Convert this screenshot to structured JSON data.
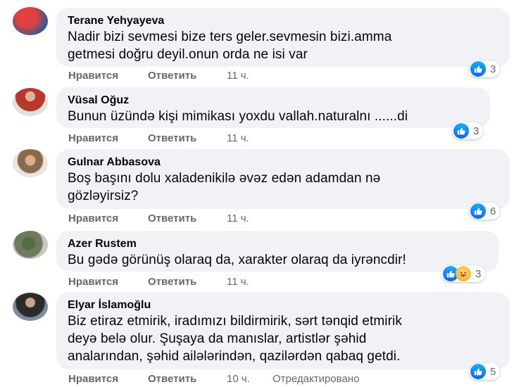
{
  "action_labels": {
    "like": "Нравится",
    "reply": "Ответить"
  },
  "comments": [
    {
      "author": "Terane Yehyayeva",
      "lines": [
        "Nadir bizi sevmesi bize ters geler.sevmesin bizi.amma",
        "getmesi doğru deyil.onun orda ne isi var"
      ],
      "time": "11 ч.",
      "reaction_count": "3",
      "reactions": [
        "like-icon"
      ],
      "avatar_colors": [
        "#c8202a",
        "#3a5a8c"
      ]
    },
    {
      "author": "Vüsal Oğuz",
      "lines": [
        "Bunun üzündə kişi mimikası yoxdu vallah.naturalnı ......di"
      ],
      "time": "11 ч.",
      "reaction_count": "3",
      "reactions": [
        "like-icon"
      ],
      "avatar_colors": [
        "#b9372b",
        "#e3e0dc"
      ]
    },
    {
      "author": "Gulnar Abbasova",
      "lines": [
        "Boş başını dolu xaladenikilə əvəz edən adamdan nə",
        "gözləyirsiz?"
      ],
      "time": "11 ч.",
      "reaction_count": "6",
      "reactions": [
        "like-icon"
      ],
      "avatar_colors": [
        "#8a6a4a",
        "#e9e6e2"
      ]
    },
    {
      "author": "Azer Rustem",
      "lines": [
        "Bu gədə görünüş olaraq da, xarakter olaraq da iyrəncdir!"
      ],
      "time": "11 ч.",
      "reaction_count": "3",
      "reactions": [
        "like-icon",
        "haha-icon"
      ],
      "avatar_colors": [
        "#6f7a5f",
        "#c9c7c0"
      ]
    },
    {
      "author": "Elyar İslamoğlu",
      "lines": [
        "Biz etiraz etmirik, iradımızı bildirmirik, sərt tənqid etmirik",
        "deyə belə olur. Şuşaya da manıslar, artistlər şəhid",
        "analarından, şəhid ailələrindən, qazilərdən qabaq getdi."
      ],
      "time": "10 ч.",
      "edited": "Отредактировано",
      "reaction_count": "5",
      "reactions": [
        "like-icon"
      ],
      "avatar_colors": [
        "#2b2b2b",
        "#7a8fa6"
      ]
    }
  ]
}
